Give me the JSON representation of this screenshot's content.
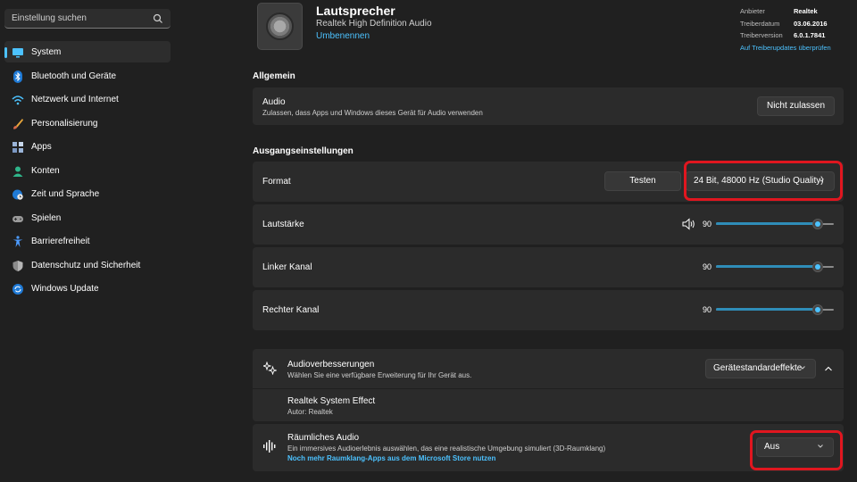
{
  "search": {
    "placeholder": "Einstellung suchen"
  },
  "sidebar": {
    "items": [
      {
        "label": "System",
        "icon": "monitor-icon",
        "active": true
      },
      {
        "label": "Bluetooth und Geräte",
        "icon": "bluetooth-icon"
      },
      {
        "label": "Netzwerk und Internet",
        "icon": "wifi-icon"
      },
      {
        "label": "Personalisierung",
        "icon": "brush-icon"
      },
      {
        "label": "Apps",
        "icon": "apps-icon"
      },
      {
        "label": "Konten",
        "icon": "person-icon"
      },
      {
        "label": "Zeit und Sprache",
        "icon": "globe-clock-icon"
      },
      {
        "label": "Spielen",
        "icon": "gamepad-icon"
      },
      {
        "label": "Barrierefreiheit",
        "icon": "accessibility-icon"
      },
      {
        "label": "Datenschutz und Sicherheit",
        "icon": "shield-icon"
      },
      {
        "label": "Windows Update",
        "icon": "update-icon"
      }
    ]
  },
  "device": {
    "name": "Lautsprecher",
    "driver_name": "Realtek High Definition Audio",
    "rename_label": "Umbenennen"
  },
  "meta": {
    "provider_key": "Anbieter",
    "provider_val": "Realtek",
    "date_key": "Treiberdatum",
    "date_val": "03.06.2016",
    "version_key": "Treiberversion",
    "version_val": "6.0.1.7841",
    "update_link": "Auf Treiberupdates überprüfen"
  },
  "general": {
    "title": "Allgemein",
    "audio_label": "Audio",
    "audio_desc": "Zulassen, dass Apps und Windows dieses Gerät für Audio verwenden",
    "audio_button": "Nicht zulassen"
  },
  "output": {
    "title": "Ausgangseinstellungen",
    "format_label": "Format",
    "test_button": "Testen",
    "format_value": "24 Bit, 48000 Hz (Studio Quality)",
    "volume_label": "Lautstärke",
    "volume_value": "90",
    "left_label": "Linker Kanal",
    "left_value": "90",
    "right_label": "Rechter Kanal",
    "right_value": "90"
  },
  "enhancements": {
    "label": "Audioverbesserungen",
    "desc": "Wählen Sie eine verfügbare Erweiterung für Ihr Gerät aus.",
    "dropdown": "Gerätestandardeffekte",
    "effect_name": "Realtek System Effect",
    "effect_author": "Autor: Realtek"
  },
  "spatial": {
    "label": "Räumliches Audio",
    "desc": "Ein immersives Audioerlebnis auswählen, das eine realistische Umgebung simuliert (3D-Raumklang)",
    "link": "Noch mehr Raumklang-Apps aus dem Microsoft Store nutzen",
    "dropdown": "Aus"
  },
  "colors": {
    "accent": "#4cc2ff",
    "highlight": "#e0161f",
    "card": "#2b2b2b",
    "background": "#202020"
  }
}
